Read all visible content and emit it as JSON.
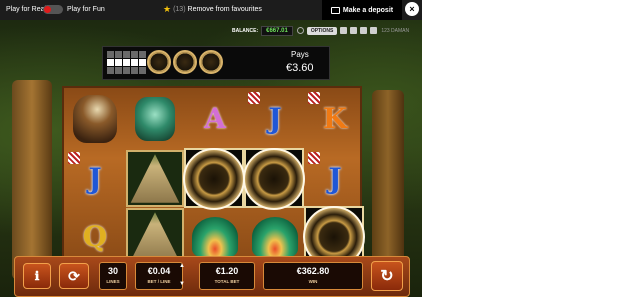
{
  "topbar": {
    "play_real": "Play for Real",
    "play_fun": "Play for Fun",
    "fav_count": "(13)",
    "fav_label": "Remove from favourites",
    "deposit": "Make a deposit",
    "close": "×"
  },
  "info": {
    "balance_label": "BALANCE:",
    "balance_value": "€667.01",
    "options": "OPTIONS",
    "version": "123 DAMAN"
  },
  "pays": {
    "label": "Pays",
    "value": "€3.60"
  },
  "reels": {
    "r1": [
      "J",
      "J",
      "Q"
    ],
    "letters": {
      "a": "A",
      "j": "J",
      "k": "K",
      "j2": "J"
    }
  },
  "controls": {
    "lines_value": "30",
    "lines_label": "LINES",
    "bet_line_value": "€0.04",
    "bet_line_label": "BET / LINE",
    "total_bet_value": "€1.20",
    "total_bet_label": "TOTAL BET",
    "win_value": "€362.80",
    "win_label": "WIN"
  },
  "colors": {
    "balance": "#6fe35b",
    "accent": "#c8541d"
  }
}
